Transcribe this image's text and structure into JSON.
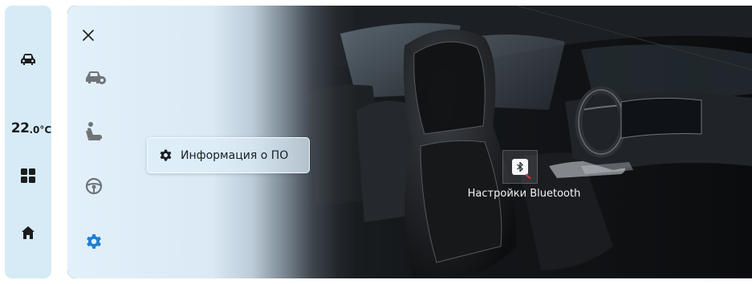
{
  "dock": {
    "temperature_integer": "22",
    "temperature_decimal": ".0",
    "temperature_unit": "°C",
    "icons": [
      "car-icon",
      "apps-grid-icon",
      "home-icon"
    ]
  },
  "menu": {
    "icons": [
      "close-icon",
      "car-settings-icon",
      "seat-icon",
      "steering-wheel-icon",
      "gear-icon"
    ],
    "active_item": "gear-icon"
  },
  "popup": {
    "label": "Информация о ПО",
    "icon": "gear-icon"
  },
  "hotspot": {
    "label": "Настройки Bluetooth",
    "icon": "bluetooth-icon"
  },
  "colors": {
    "accent": "#1f7fd0",
    "dock_bg": "#d6ebf6",
    "icon_dark": "#1c1c1c",
    "icon_gray": "#6f7478"
  }
}
